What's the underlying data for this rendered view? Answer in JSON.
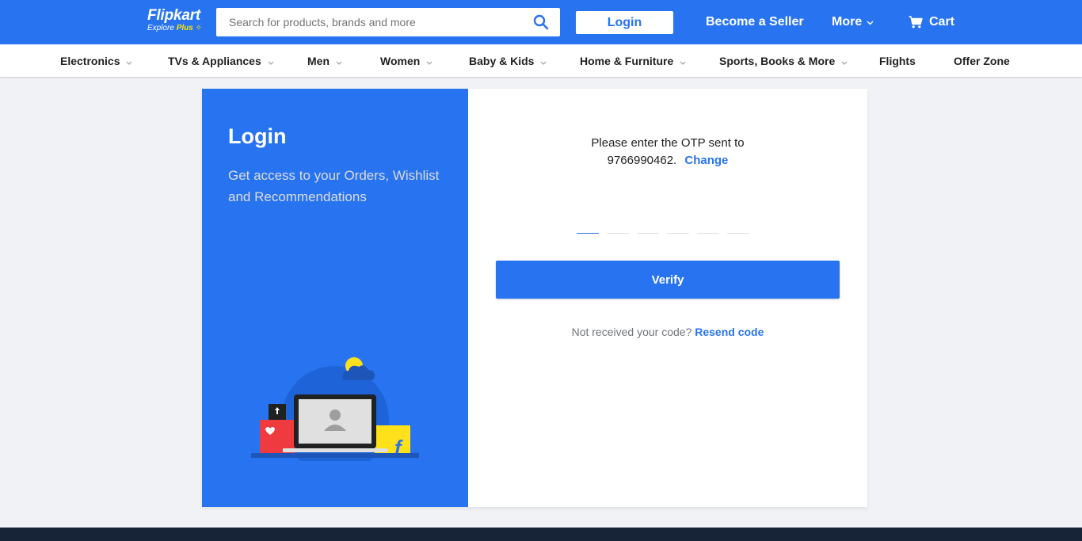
{
  "header": {
    "logo": {
      "brand": "Flipkart",
      "tagline_prefix": "Explore",
      "tagline_plus": "Plus"
    },
    "search": {
      "placeholder": "Search for products, brands and more"
    },
    "login_label": "Login",
    "seller_label": "Become a Seller",
    "more_label": "More",
    "cart_label": "Cart",
    "colors": {
      "primary": "#2874f0",
      "accent": "#ffe500"
    }
  },
  "categories": [
    {
      "label": "Electronics",
      "has_dropdown": true
    },
    {
      "label": "TVs & Appliances",
      "has_dropdown": true
    },
    {
      "label": "Men",
      "has_dropdown": true
    },
    {
      "label": "Women",
      "has_dropdown": true
    },
    {
      "label": "Baby & Kids",
      "has_dropdown": true
    },
    {
      "label": "Home & Furniture",
      "has_dropdown": true
    },
    {
      "label": "Sports, Books & More",
      "has_dropdown": true
    },
    {
      "label": "Flights",
      "has_dropdown": false
    },
    {
      "label": "Offer Zone",
      "has_dropdown": false
    }
  ],
  "login_panel": {
    "title": "Login",
    "subtitle": "Get access to your Orders, Wishlist and Recommendations"
  },
  "otp": {
    "message": "Please enter the OTP sent to",
    "phone": "9766990462.",
    "change_label": "Change",
    "digit_count": 6,
    "verify_label": "Verify",
    "resend_prompt": "Not received your code?",
    "resend_label": "Resend code"
  },
  "icons": {
    "search": "search-icon",
    "cart": "cart-icon",
    "more_chevron": "chevron-down-icon"
  }
}
